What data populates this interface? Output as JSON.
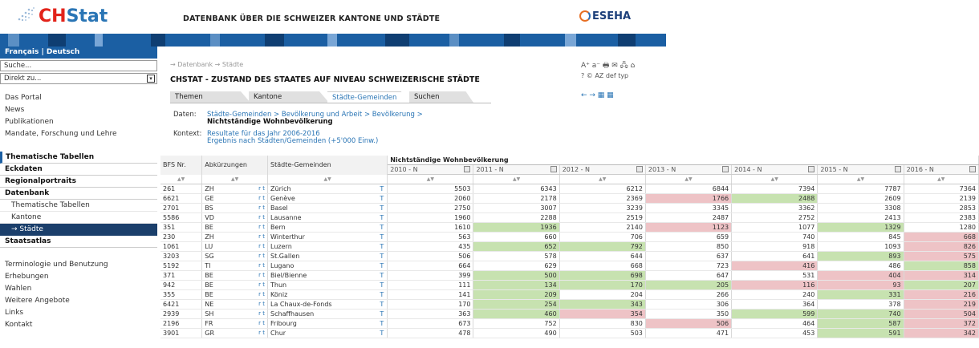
{
  "header": {
    "logo_text": "CHStat",
    "title": "DATENBANK ÜBER DIE SCHWEIZER KANTONE UND STÄDTE",
    "partner_logo": "ESEHA"
  },
  "sidebar": {
    "lang_fr": "Français",
    "lang_sep": " | ",
    "lang_de": "Deutsch",
    "search_placeholder": "Suche...",
    "direct_label": "Direkt zu...",
    "links_top": [
      "Das Portal",
      "News",
      "Publikationen",
      "Mandate, Forschung und Lehre"
    ],
    "sections": {
      "thematische": "Thematische Tabellen",
      "eckdaten": "Eckdaten",
      "regional": "Regionalportraits",
      "datenbank": "Datenbank",
      "sub_thematische": "Thematische Tabellen",
      "sub_kantone": "Kantone",
      "sub_staedte": "→ Städte",
      "staatsatlas": "Staatsatlas"
    },
    "links_bottom": [
      "Terminologie und Benutzung",
      "Erhebungen",
      "Wahlen",
      "Weitere Angebote",
      "Links",
      "Kontakt"
    ]
  },
  "content": {
    "breadcrumb": "→ Datenbank → Städte",
    "title": "CHSTAT - ZUSTAND DES STAATES AUF NIVEAU SCHWEIZERISCHE STÄDTE",
    "tools_line1": "A⁺ a⁻ 🖶 ✉ 🖧 ⌂",
    "tools_line2": "? © AZ def typ",
    "tools_line3": "← → ▦ ▦",
    "tabs": [
      "Themen",
      "Kantone",
      "Städte-Gemeinden",
      "Suchen"
    ],
    "daten_label": "Daten:",
    "daten_path": "Städte-Gemeinden > Bevölkerung und Arbeit > Bevölkerung >",
    "daten_title": "Nichtständige Wohnbevölkerung",
    "kontext_label": "Kontext:",
    "kontext_1": "Resultate für das Jahr 2006-2016",
    "kontext_2": "Ergebnis nach Städten/Gemeinden (+5'000 Einw.)"
  },
  "table": {
    "col_bfs": "BFS Nr.",
    "col_abk": "Abkürzungen",
    "col_staedte": "Städte-Gemeinden",
    "group_header": "Nichtständige Wohnbevölkerung",
    "sort_marker": "▲▼",
    "years": [
      "2010 - N",
      "2011 - N",
      "2012 - N",
      "2013 - N",
      "2014 - N",
      "2015 - N",
      "2016 - N"
    ],
    "rows": [
      {
        "bfs": "261",
        "abk": "ZH",
        "rt": "r t",
        "name": "Zürich",
        "t": "T",
        "vals": [
          "5503",
          "6343",
          "6212",
          "6844",
          "7394",
          "7787",
          "7364"
        ],
        "hl": [
          "",
          "",
          "",
          "",
          "",
          "",
          ""
        ]
      },
      {
        "bfs": "6621",
        "abk": "GE",
        "rt": "r t",
        "name": "Genève",
        "t": "T",
        "vals": [
          "2060",
          "2178",
          "2369",
          "1766",
          "2488",
          "2609",
          "2139"
        ],
        "hl": [
          "",
          "",
          "",
          "r",
          "g",
          "",
          ""
        ]
      },
      {
        "bfs": "2701",
        "abk": "BS",
        "rt": "r t",
        "name": "Basel",
        "t": "T",
        "vals": [
          "2750",
          "3007",
          "3239",
          "3345",
          "3362",
          "3308",
          "2853"
        ],
        "hl": [
          "",
          "",
          "",
          "",
          "",
          "",
          ""
        ]
      },
      {
        "bfs": "5586",
        "abk": "VD",
        "rt": "r t",
        "name": "Lausanne",
        "t": "T",
        "vals": [
          "1960",
          "2288",
          "2519",
          "2487",
          "2752",
          "2413",
          "2383"
        ],
        "hl": [
          "",
          "",
          "",
          "",
          "",
          "",
          ""
        ]
      },
      {
        "bfs": "351",
        "abk": "BE",
        "rt": "r t",
        "name": "Bern",
        "t": "T",
        "vals": [
          "1610",
          "1936",
          "2140",
          "1123",
          "1077",
          "1329",
          "1280"
        ],
        "hl": [
          "",
          "g",
          "",
          "r",
          "",
          "g",
          ""
        ]
      },
      {
        "bfs": "230",
        "abk": "ZH",
        "rt": "r t",
        "name": "Winterthur",
        "t": "T",
        "vals": [
          "563",
          "660",
          "706",
          "659",
          "740",
          "845",
          "668"
        ],
        "hl": [
          "",
          "",
          "",
          "",
          "",
          "",
          "r"
        ]
      },
      {
        "bfs": "1061",
        "abk": "LU",
        "rt": "r t",
        "name": "Luzern",
        "t": "T",
        "vals": [
          "435",
          "652",
          "792",
          "850",
          "918",
          "1093",
          "826"
        ],
        "hl": [
          "",
          "g",
          "g",
          "",
          "",
          "",
          "r"
        ]
      },
      {
        "bfs": "3203",
        "abk": "SG",
        "rt": "r t",
        "name": "St.Gallen",
        "t": "T",
        "vals": [
          "506",
          "578",
          "644",
          "637",
          "641",
          "893",
          "575"
        ],
        "hl": [
          "",
          "",
          "",
          "",
          "",
          "g",
          "r"
        ]
      },
      {
        "bfs": "5192",
        "abk": "TI",
        "rt": "r t",
        "name": "Lugano",
        "t": "T",
        "vals": [
          "664",
          "629",
          "668",
          "723",
          "416",
          "486",
          "858"
        ],
        "hl": [
          "",
          "",
          "",
          "",
          "r",
          "",
          "g"
        ]
      },
      {
        "bfs": "371",
        "abk": "BE",
        "rt": "r t",
        "name": "Biel/Bienne",
        "t": "T",
        "vals": [
          "399",
          "500",
          "698",
          "647",
          "531",
          "404",
          "314"
        ],
        "hl": [
          "",
          "g",
          "g",
          "",
          "",
          "r",
          "r"
        ]
      },
      {
        "bfs": "942",
        "abk": "BE",
        "rt": "r t",
        "name": "Thun",
        "t": "T",
        "vals": [
          "111",
          "134",
          "170",
          "205",
          "116",
          "93",
          "207"
        ],
        "hl": [
          "",
          "g",
          "g",
          "g",
          "r",
          "r",
          "g"
        ]
      },
      {
        "bfs": "355",
        "abk": "BE",
        "rt": "r t",
        "name": "Köniz",
        "t": "T",
        "vals": [
          "141",
          "209",
          "204",
          "266",
          "240",
          "331",
          "216"
        ],
        "hl": [
          "",
          "g",
          "",
          "",
          "",
          "g",
          "r"
        ]
      },
      {
        "bfs": "6421",
        "abk": "NE",
        "rt": "r t",
        "name": "La Chaux-de-Fonds",
        "t": "T",
        "vals": [
          "170",
          "254",
          "343",
          "306",
          "364",
          "378",
          "219"
        ],
        "hl": [
          "",
          "g",
          "g",
          "",
          "",
          "",
          "r"
        ]
      },
      {
        "bfs": "2939",
        "abk": "SH",
        "rt": "r t",
        "name": "Schaffhausen",
        "t": "T",
        "vals": [
          "363",
          "460",
          "354",
          "350",
          "599",
          "740",
          "504"
        ],
        "hl": [
          "",
          "g",
          "r",
          "",
          "g",
          "g",
          "r"
        ]
      },
      {
        "bfs": "2196",
        "abk": "FR",
        "rt": "r t",
        "name": "Fribourg",
        "t": "T",
        "vals": [
          "673",
          "752",
          "830",
          "506",
          "464",
          "587",
          "372"
        ],
        "hl": [
          "",
          "",
          "",
          "r",
          "",
          "g",
          "r"
        ]
      },
      {
        "bfs": "3901",
        "abk": "GR",
        "rt": "r t",
        "name": "Chur",
        "t": "T",
        "vals": [
          "478",
          "490",
          "503",
          "471",
          "453",
          "591",
          "342"
        ],
        "hl": [
          "",
          "",
          "",
          "",
          "",
          "g",
          "r"
        ]
      }
    ]
  },
  "colors": {
    "brand_blue": "#1b5fa3",
    "highlight_green": "#c7e2b0",
    "highlight_red": "#eec3c6"
  }
}
